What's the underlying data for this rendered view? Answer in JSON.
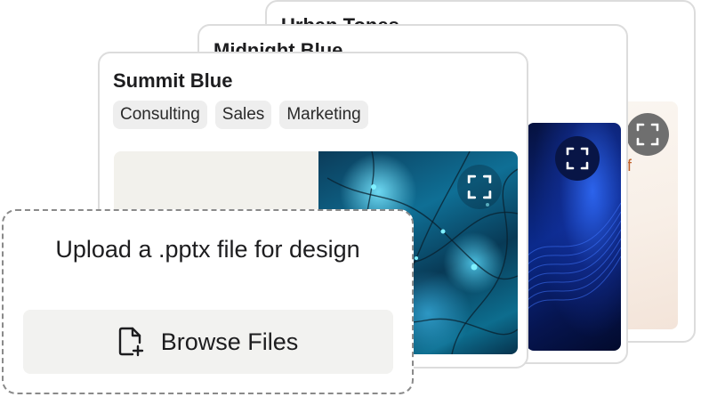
{
  "cards": [
    {
      "title": "Urban Tones",
      "accent_letter": "f"
    },
    {
      "title": "Midnight Blue"
    },
    {
      "title": "Summit Blue",
      "tags": [
        "Consulting",
        "Sales",
        "Marketing"
      ]
    }
  ],
  "upload": {
    "prompt": "Upload a .pptx file for design",
    "browse_label": "Browse Files"
  },
  "icons": {
    "expand": "expand-icon",
    "file_add": "file-add-icon"
  }
}
